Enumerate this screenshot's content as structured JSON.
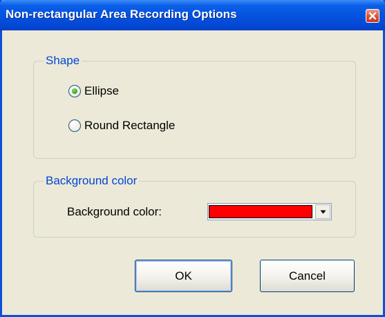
{
  "window": {
    "title": "Non-rectangular Area Recording Options",
    "close_icon": "close-icon"
  },
  "shape_group": {
    "legend": "Shape",
    "options": [
      {
        "label": "Ellipse",
        "selected": true
      },
      {
        "label": "Round Rectangle",
        "selected": false
      }
    ]
  },
  "background_group": {
    "legend": "Background color",
    "field_label": "Background color:",
    "selected_color": "#ff0000",
    "dropdown_icon": "chevron-down-icon"
  },
  "buttons": {
    "ok": "OK",
    "cancel": "Cancel"
  },
  "colors": {
    "accent": "#0046d5",
    "titlebar": "#0553e0",
    "dialog_bg": "#ece9d8"
  }
}
